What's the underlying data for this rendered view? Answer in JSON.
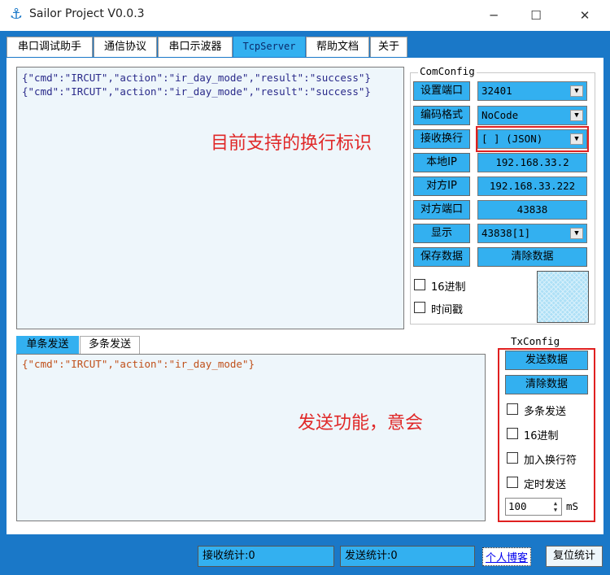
{
  "window": {
    "title": "Sailor Project V0.0.3",
    "minimize": "─",
    "maximize": "☐",
    "close": "✕",
    "icon": "anchor-icon"
  },
  "tabs": [
    {
      "label": "串口调试助手",
      "active": false
    },
    {
      "label": "通信协议",
      "active": false
    },
    {
      "label": "串口示波器",
      "active": false
    },
    {
      "label": "TcpServer",
      "active": true
    },
    {
      "label": "帮助文档",
      "active": false
    },
    {
      "label": "关于",
      "active": false
    }
  ],
  "receive": {
    "lines": "{\"cmd\":\"IRCUT\",\"action\":\"ir_day_mode\",\"result\":\"success\"}\n{\"cmd\":\"IRCUT\",\"action\":\"ir_day_mode\",\"result\":\"success\"}"
  },
  "comconfig": {
    "title": "ComConfig",
    "set_port_label": "设置端口",
    "port_value": "32401",
    "encoding_label": "编码格式",
    "encoding_value": "NoCode",
    "newline_label": "接收换行",
    "newline_value": "[ ] (JSON)",
    "local_ip_label": "本地IP",
    "local_ip_value": "192.168.33.2",
    "remote_ip_label": "对方IP",
    "remote_ip_value": "192.168.33.222",
    "remote_port_label": "对方端口",
    "remote_port_value": "43838",
    "display_label": "显示",
    "display_value": "43838[1]",
    "save_data_label": "保存数据",
    "clear_data_label": "清除数据",
    "hex_label": "16进制",
    "timestamp_label": "时间戳"
  },
  "send": {
    "tab_single": "单条发送",
    "tab_multi": "多条发送",
    "content": "{\"cmd\":\"IRCUT\",\"action\":\"ir_day_mode\"}"
  },
  "txconfig": {
    "title": "TxConfig",
    "send_label": "发送数据",
    "clear_label": "清除数据",
    "multi_send_label": "多条发送",
    "hex_label": "16进制",
    "add_newline_label": "加入换行符",
    "timed_send_label": "定时发送",
    "interval_value": "100",
    "unit": "mS"
  },
  "annotations": {
    "newline_note": "目前支持的换行标识",
    "send_note": "发送功能，意会",
    "color": "#e02828"
  },
  "statusbar": {
    "recv_stats": "接收统计:0",
    "send_stats": "发送统计:0",
    "blog_link": "个人博客",
    "reset_label": "复位统计"
  },
  "colors": {
    "accent": "#33b0f0",
    "frame": "#1a78c8"
  }
}
